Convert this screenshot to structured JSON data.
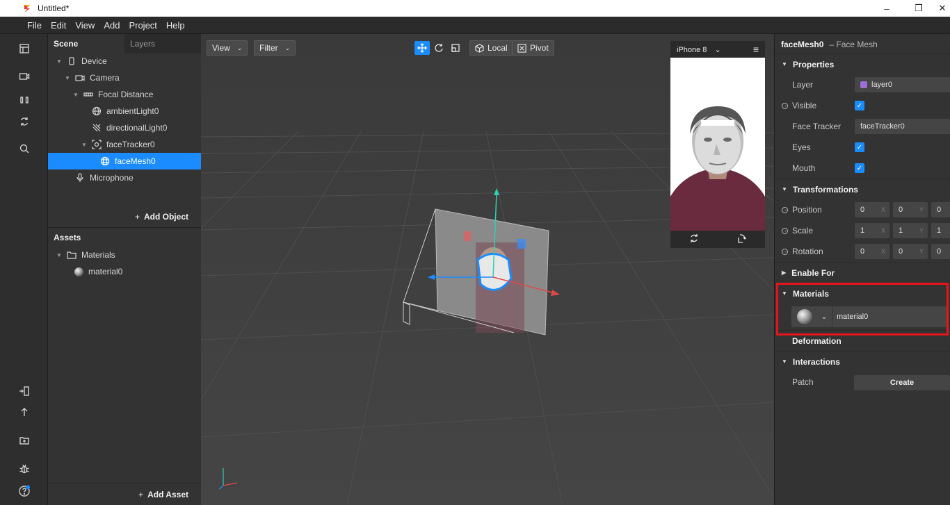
{
  "window": {
    "title": "Untitled*",
    "minimize": "–",
    "restore": "❐",
    "close": "✕"
  },
  "menu": [
    "File",
    "Edit",
    "View",
    "Add",
    "Project",
    "Help"
  ],
  "rail_icons": [
    "layout-icon",
    "camera-icon",
    "pause-icon",
    "sync-icon",
    "search-icon",
    "import-icon",
    "upload-icon",
    "add-folder-icon",
    "bug-icon",
    "help-icon"
  ],
  "scene": {
    "tabs": [
      "Scene",
      "Layers"
    ],
    "tree": [
      {
        "label": "Device",
        "icon": "phone-icon"
      },
      {
        "label": "Camera",
        "icon": "camera-icon"
      },
      {
        "label": "Focal Distance",
        "icon": "focal-distance-icon"
      },
      {
        "label": "ambientLight0",
        "icon": "ambient-light-icon"
      },
      {
        "label": "directionalLight0",
        "icon": "directional-light-icon"
      },
      {
        "label": "faceTracker0",
        "icon": "face-tracker-icon"
      },
      {
        "label": "faceMesh0",
        "icon": "face-mesh-icon"
      },
      {
        "label": "Microphone",
        "icon": "microphone-icon"
      }
    ],
    "add_object": "Add Object",
    "plus": "+"
  },
  "assets": {
    "title": "Assets",
    "folder": "Materials",
    "item": "material0",
    "add_asset": "Add Asset",
    "plus": "+"
  },
  "viewport": {
    "view_label": "View",
    "filter_label": "Filter",
    "local_label": "Local",
    "pivot_label": "Pivot",
    "chevron": "⌄"
  },
  "preview": {
    "device": "iPhone 8",
    "chevron": "⌄",
    "menu": "≡"
  },
  "inspector": {
    "object_name": "faceMesh0",
    "object_type": "– Face Mesh",
    "properties_title": "Properties",
    "layer_label": "Layer",
    "layer_value": "layer0",
    "layer_color": "#9b6fd6",
    "visible_label": "Visible",
    "face_tracker_label": "Face Tracker",
    "face_tracker_value": "faceTracker0",
    "eyes_label": "Eyes",
    "mouth_label": "Mouth",
    "check": "✓",
    "transformations_title": "Transformations",
    "position_label": "Position",
    "position": [
      "0",
      "0",
      "0"
    ],
    "scale_label": "Scale",
    "scale": [
      "1",
      "1",
      "1"
    ],
    "rotation_label": "Rotation",
    "rotation": [
      "0",
      "0",
      "0"
    ],
    "axis_x": "X",
    "axis_y": "Y",
    "enable_for_title": "Enable For",
    "materials_title": "Materials",
    "material_value": "material0",
    "deformation_title": "Deformation",
    "interactions_title": "Interactions",
    "patch_label": "Patch",
    "create_label": "Create"
  },
  "colors": {
    "accent": "#1a8cff",
    "highlight": "#e8141b"
  }
}
